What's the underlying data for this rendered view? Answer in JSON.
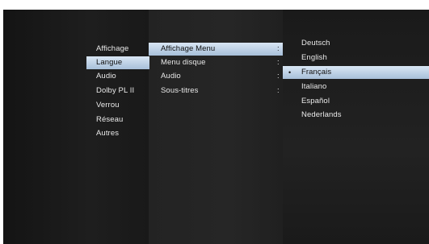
{
  "menu_col1": {
    "items": [
      {
        "label": "Affichage"
      },
      {
        "label": "Langue"
      },
      {
        "label": "Audio"
      },
      {
        "label": "Dolby PL II"
      },
      {
        "label": "Verrou"
      },
      {
        "label": "Réseau"
      },
      {
        "label": "Autres"
      }
    ],
    "selected": "Langue"
  },
  "menu_col2": {
    "items": [
      {
        "label": "Affichage Menu",
        "sep": ":"
      },
      {
        "label": "Menu disque",
        "sep": ":"
      },
      {
        "label": "Audio",
        "sep": ":"
      },
      {
        "label": "Sous-titres",
        "sep": ":"
      }
    ],
    "selected": "Affichage Menu"
  },
  "menu_col3": {
    "items": [
      {
        "label": "Deutsch"
      },
      {
        "label": "English"
      },
      {
        "label": "Français"
      },
      {
        "label": "Italiano"
      },
      {
        "label": "Español"
      },
      {
        "label": "Nederlands"
      }
    ],
    "selected": "Français",
    "selected_marker": "•"
  },
  "colors": {
    "highlight": "#c4d6ea",
    "text": "#e9e9e9",
    "background": "#1a1a1a"
  }
}
